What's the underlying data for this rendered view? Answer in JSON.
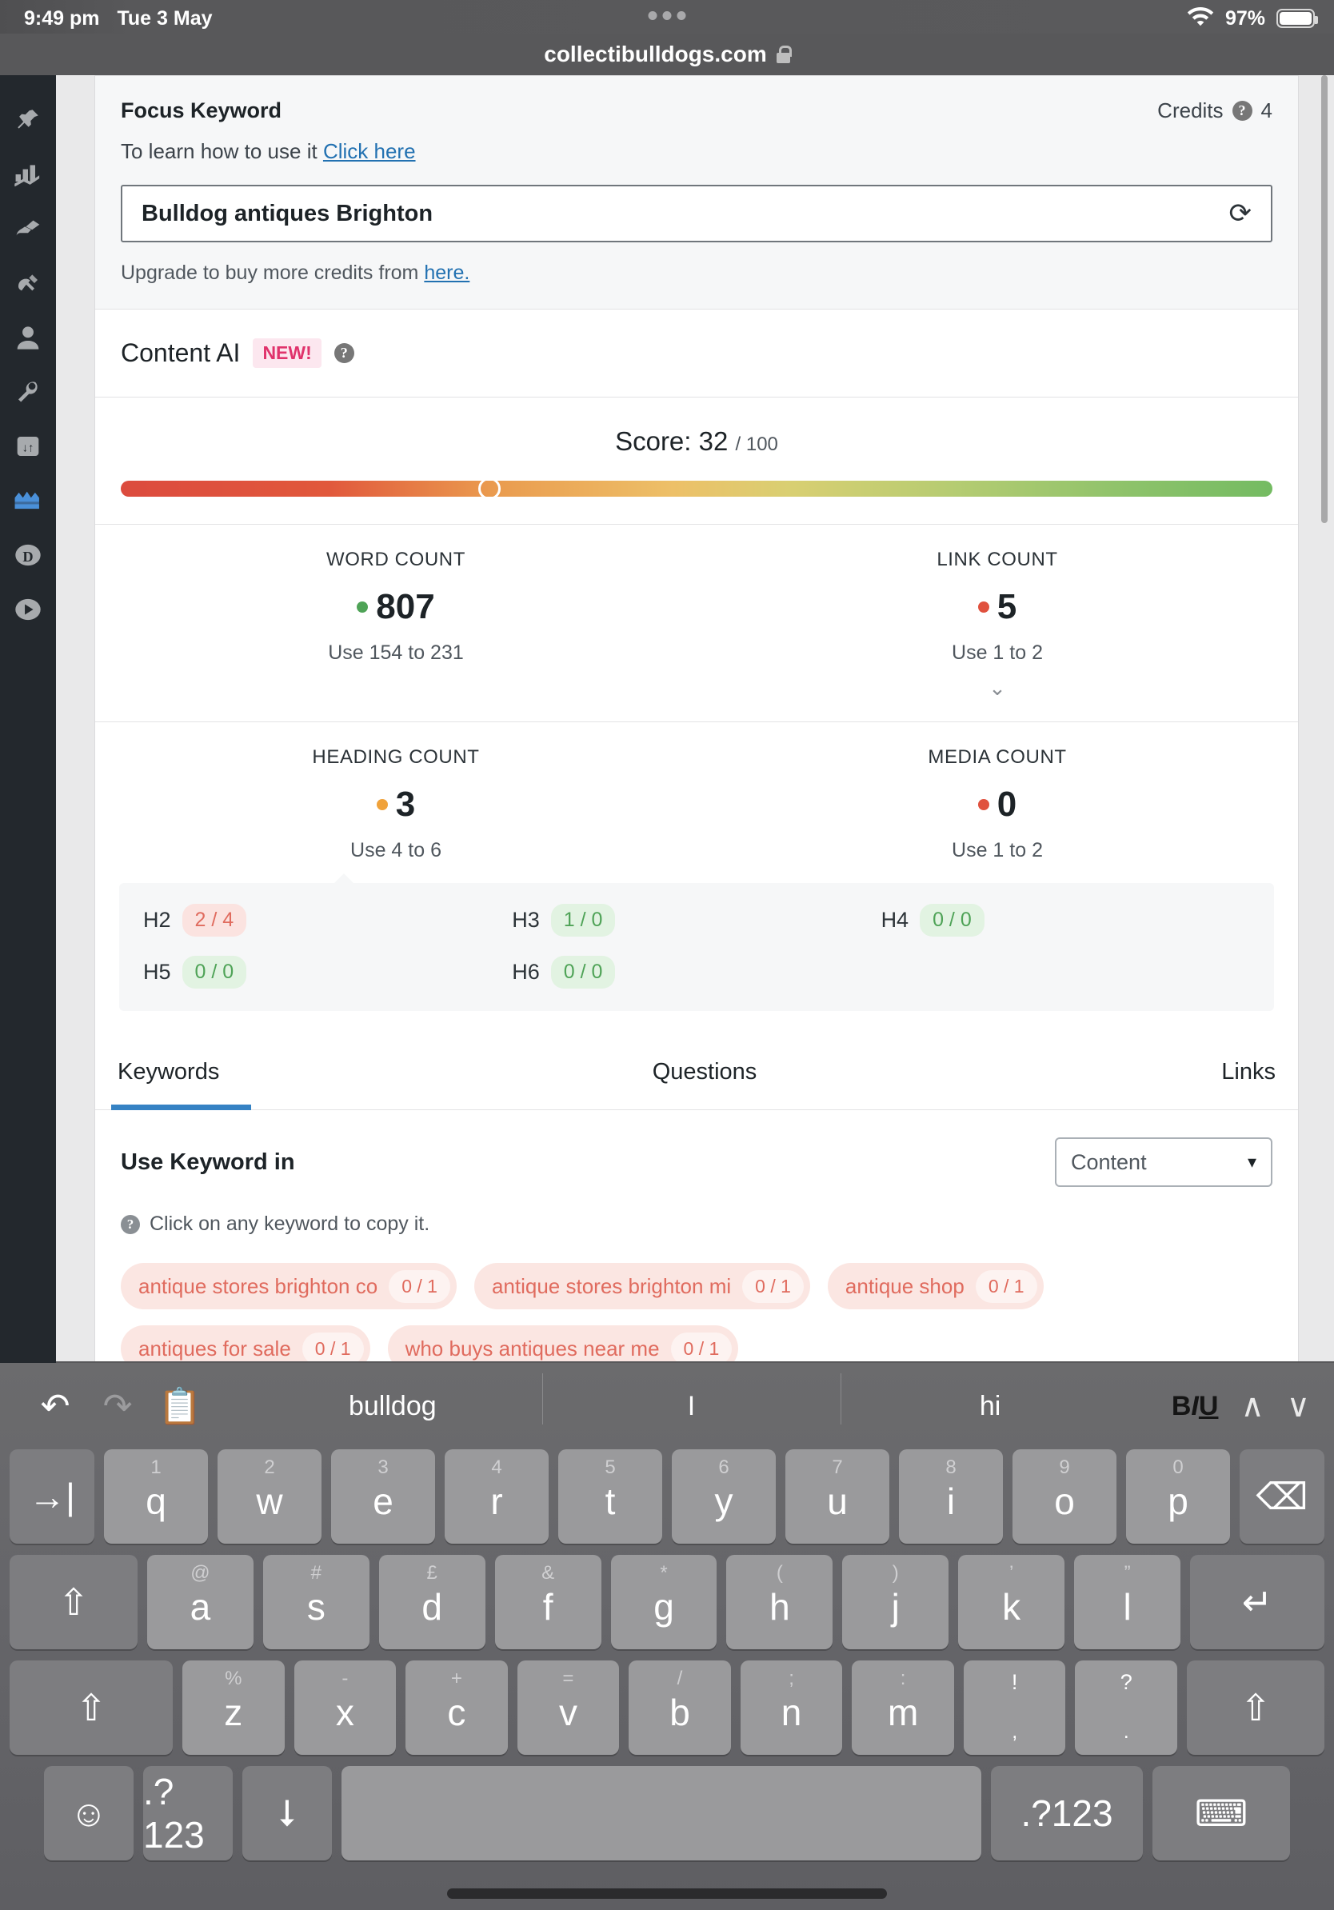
{
  "statusbar": {
    "time": "9:49 pm",
    "date": "Tue 3 May",
    "battery_pct": "97%"
  },
  "browser": {
    "url": "collectibulldogs.com"
  },
  "sidebar": {
    "items": [
      {
        "name": "pin-icon"
      },
      {
        "name": "analytics-icon"
      },
      {
        "name": "brush-icon"
      },
      {
        "name": "plug-icon"
      },
      {
        "name": "user-icon"
      },
      {
        "name": "wrench-icon"
      },
      {
        "name": "seo-icon"
      },
      {
        "name": "rank-math-icon"
      },
      {
        "name": "d-circle-icon"
      },
      {
        "name": "play-circle-icon"
      }
    ]
  },
  "focus_keyword": {
    "title": "Focus Keyword",
    "credits_label": "Credits",
    "credits_value": "4",
    "learn_text": "To learn how to use it",
    "learn_link": "Click here",
    "input_value": "Bulldog antiques Brighton",
    "refresh_icon": "refresh-icon",
    "upgrade_text": "Upgrade to buy more credits from",
    "upgrade_link": "here."
  },
  "content_ai": {
    "title": "Content AI",
    "badge": "NEW!"
  },
  "score": {
    "label": "Score:",
    "value": "32",
    "denominator": "/ 100",
    "percent": 32
  },
  "metrics": [
    {
      "label": "WORD COUNT",
      "value": "807",
      "dot_color": "#4fa357",
      "hint": "Use 154 to 231",
      "chevron": ""
    },
    {
      "label": "LINK COUNT",
      "value": "5",
      "dot_color": "#e0513e",
      "hint": "Use 1 to 2",
      "chevron": "⌄"
    },
    {
      "label": "HEADING COUNT",
      "value": "3",
      "dot_color": "#f0a23a",
      "hint": "Use 4 to 6",
      "chevron": ""
    },
    {
      "label": "MEDIA COUNT",
      "value": "0",
      "dot_color": "#e0513e",
      "hint": "Use 1 to 2",
      "chevron": ""
    }
  ],
  "headings": [
    {
      "name": "H2",
      "value": "2 / 4",
      "status": "red"
    },
    {
      "name": "H3",
      "value": "1 / 0",
      "status": "green"
    },
    {
      "name": "H4",
      "value": "0 / 0",
      "status": "green"
    },
    {
      "name": "H5",
      "value": "0 / 0",
      "status": "green"
    },
    {
      "name": "H6",
      "value": "0 / 0",
      "status": "green"
    }
  ],
  "tabs": [
    {
      "label": "Keywords",
      "active": true
    },
    {
      "label": "Questions",
      "active": false
    },
    {
      "label": "Links",
      "active": false
    }
  ],
  "keywords_panel": {
    "title": "Use Keyword in",
    "select_value": "Content",
    "note": "Click on any keyword to copy it.",
    "pills": [
      {
        "text": "antique stores brighton co",
        "count": "0 / 1"
      },
      {
        "text": "antique stores brighton mi",
        "count": "0 / 1"
      },
      {
        "text": "antique shop",
        "count": "0 / 1"
      },
      {
        "text": "antiques for sale",
        "count": "0 / 1"
      },
      {
        "text": "who buys antiques near me",
        "count": "0 / 1"
      }
    ]
  },
  "keyboard": {
    "toolbar": {
      "undo_icon": "undo-icon",
      "redo_icon": "redo-icon",
      "paste_icon": "clipboard-icon",
      "suggestions": [
        "bulldog",
        "I",
        "hi"
      ],
      "format_label": "BIU",
      "up_icon": "chevron-up-icon",
      "down_icon": "chevron-down-icon"
    },
    "row1": [
      {
        "main": "→|",
        "alt": "",
        "name": "tab-key",
        "cls": "dark w-tab"
      },
      {
        "main": "q",
        "alt": "1"
      },
      {
        "main": "w",
        "alt": "2"
      },
      {
        "main": "e",
        "alt": "3"
      },
      {
        "main": "r",
        "alt": "4"
      },
      {
        "main": "t",
        "alt": "5"
      },
      {
        "main": "y",
        "alt": "6"
      },
      {
        "main": "u",
        "alt": "7"
      },
      {
        "main": "i",
        "alt": "8"
      },
      {
        "main": "o",
        "alt": "9"
      },
      {
        "main": "p",
        "alt": "0"
      },
      {
        "main": "⌫",
        "alt": "",
        "name": "backspace-key",
        "cls": "dark w-bksp"
      }
    ],
    "row2": [
      {
        "main": "⇧",
        "alt": "",
        "name": "shift-key",
        "cls": "dark w-shiftl"
      },
      {
        "main": "a",
        "alt": "@"
      },
      {
        "main": "s",
        "alt": "#"
      },
      {
        "main": "d",
        "alt": "£"
      },
      {
        "main": "f",
        "alt": "&"
      },
      {
        "main": "g",
        "alt": "*"
      },
      {
        "main": "h",
        "alt": "("
      },
      {
        "main": "j",
        "alt": ")"
      },
      {
        "main": "k",
        "alt": "’"
      },
      {
        "main": "l",
        "alt": "”"
      },
      {
        "main": "↵",
        "alt": "",
        "name": "return-key",
        "cls": "dark w-ret"
      }
    ],
    "row3": [
      {
        "main": "⇧",
        "alt": "",
        "name": "shift-left-key",
        "cls": "dark w-shift"
      },
      {
        "main": "z",
        "alt": "%"
      },
      {
        "main": "x",
        "alt": "-"
      },
      {
        "main": "c",
        "alt": "+"
      },
      {
        "main": "v",
        "alt": "="
      },
      {
        "main": "b",
        "alt": "/"
      },
      {
        "main": "n",
        "alt": ";"
      },
      {
        "main": "m",
        "alt": ":"
      },
      {
        "main": ",",
        "alt": "!",
        "name": "comma-key",
        "bright": true
      },
      {
        "main": ".",
        "alt": "?",
        "name": "period-key",
        "bright": true
      },
      {
        "main": "⇧",
        "alt": "",
        "name": "shift-right-key",
        "cls": "dark w-shift2"
      }
    ],
    "row4": [
      {
        "main": "☺",
        "alt": "",
        "name": "emoji-key",
        "cls": "dark w-small"
      },
      {
        "main": ".?123",
        "alt": "",
        "name": "numbers-key-left",
        "cls": "dark w-small"
      },
      {
        "main": "⭣",
        "alt": "",
        "name": "microphone-key",
        "cls": "dark w-small"
      },
      {
        "main": "",
        "alt": "",
        "name": "space-key",
        "cls": "w-space"
      },
      {
        "main": ".?123",
        "alt": "",
        "name": "numbers-key-right",
        "cls": "dark w-num2"
      },
      {
        "main": "⌨",
        "alt": "",
        "name": "dismiss-keyboard-key",
        "cls": "dark w-dismiss"
      }
    ]
  }
}
